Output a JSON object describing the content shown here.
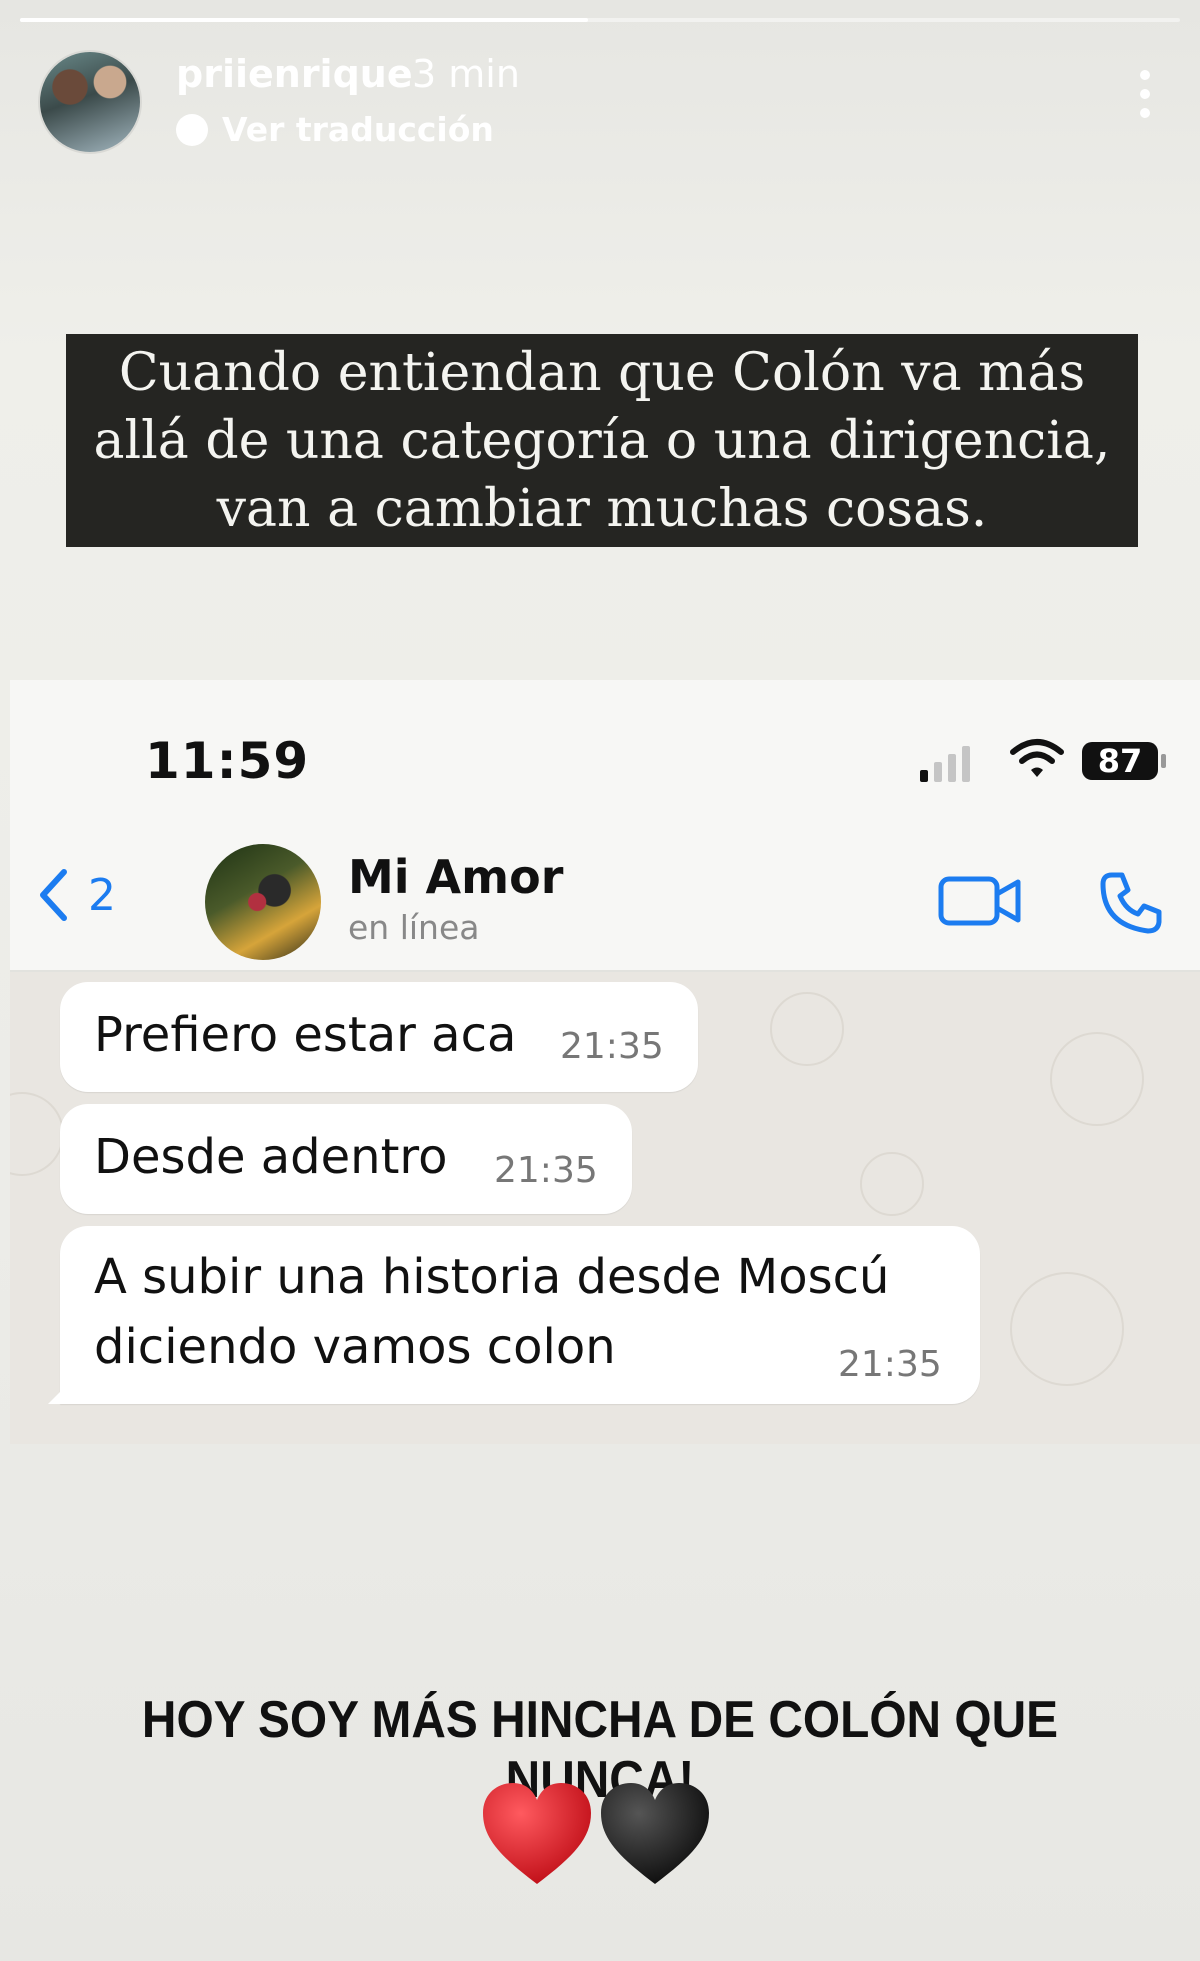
{
  "story": {
    "username": "priienrique",
    "time_ago": "3 min",
    "translate_label": "Ver traducción",
    "progress": 0.49,
    "quote": "Cuando entiendan que Colón va más allá de una categoría o una dirigencia, van a cambiar muchas cosas.",
    "caption": "HOY SOY MÁS HINCHA DE COLÓN QUE NUNCA!",
    "hearts": [
      "red-heart",
      "black-heart"
    ]
  },
  "screenshot": {
    "status_time": "11:59",
    "battery": "87",
    "back_count": "2",
    "contact_name": "Mi Amor",
    "contact_status": "en línea",
    "messages": [
      {
        "text": "Prefiero estar aca",
        "time": "21:35"
      },
      {
        "text": "Desde adentro",
        "time": "21:35"
      },
      {
        "line1": "A subir una historia desde Moscú",
        "line2": "diciendo vamos colon",
        "time": "21:35"
      }
    ]
  },
  "colors": {
    "accent": "#1c7cf0",
    "quote_bg": "#252522",
    "heart_red": "#d81e25",
    "heart_black": "#1a1a1a"
  }
}
